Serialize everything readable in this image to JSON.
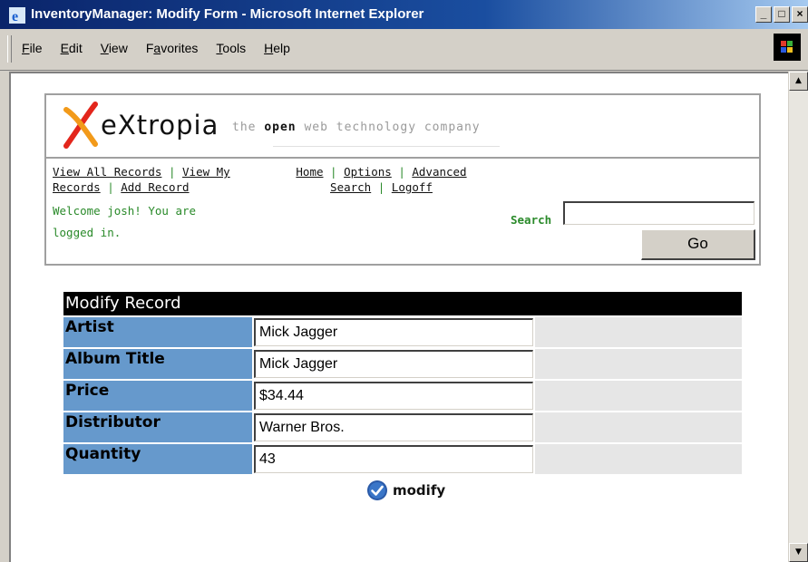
{
  "window": {
    "title": "InventoryManager: Modify Form - Microsoft Internet Explorer",
    "controls": [
      "_",
      "□",
      "×"
    ]
  },
  "menu": {
    "items": [
      {
        "label": "File",
        "accel": "F",
        "rest": "ile"
      },
      {
        "label": "Edit",
        "accel": "E",
        "rest": "dit"
      },
      {
        "label": "View",
        "accel": "V",
        "rest": "iew"
      },
      {
        "label": "Favorites",
        "accel": "a",
        "pre": "F",
        "rest": "vorites"
      },
      {
        "label": "Tools",
        "accel": "T",
        "rest": "ools"
      },
      {
        "label": "Help",
        "accel": "H",
        "rest": "elp"
      }
    ]
  },
  "header": {
    "logo_text": "eXtropia",
    "tagline_pre": "the ",
    "tagline_bold": "open",
    "tagline_post": " web technology company",
    "nav_left": {
      "view_all": "View All Records",
      "view_my": "View My Records",
      "add": "Add Record",
      "separator": "|"
    },
    "nav_center": {
      "home": "Home",
      "options": "Options",
      "advanced": "Advanced Search",
      "logoff": "Logoff",
      "separator": "|"
    },
    "welcome": "Welcome josh! You are logged in.",
    "search_label": "Search",
    "search_value": "",
    "go_label": "Go"
  },
  "form": {
    "title": "Modify Record",
    "fields": [
      {
        "label": "Artist",
        "value": "Mick Jagger"
      },
      {
        "label": "Album Title",
        "value": "Mick Jagger"
      },
      {
        "label": "Price",
        "value": "$34.44"
      },
      {
        "label": "Distributor",
        "value": "Warner Bros."
      },
      {
        "label": "Quantity",
        "value": "43"
      }
    ],
    "submit_label": "modify"
  },
  "colors": {
    "label_bg": "#6699cc",
    "header_bg": "#000000",
    "accent_green": "#2a8a2a",
    "titlebar": "#0a246a"
  },
  "icons": [
    "ie-logo-icon",
    "windows-logo-icon",
    "extropia-logo-icon",
    "checkmark-circle-icon",
    "scroll-up-icon",
    "scroll-down-icon"
  ]
}
